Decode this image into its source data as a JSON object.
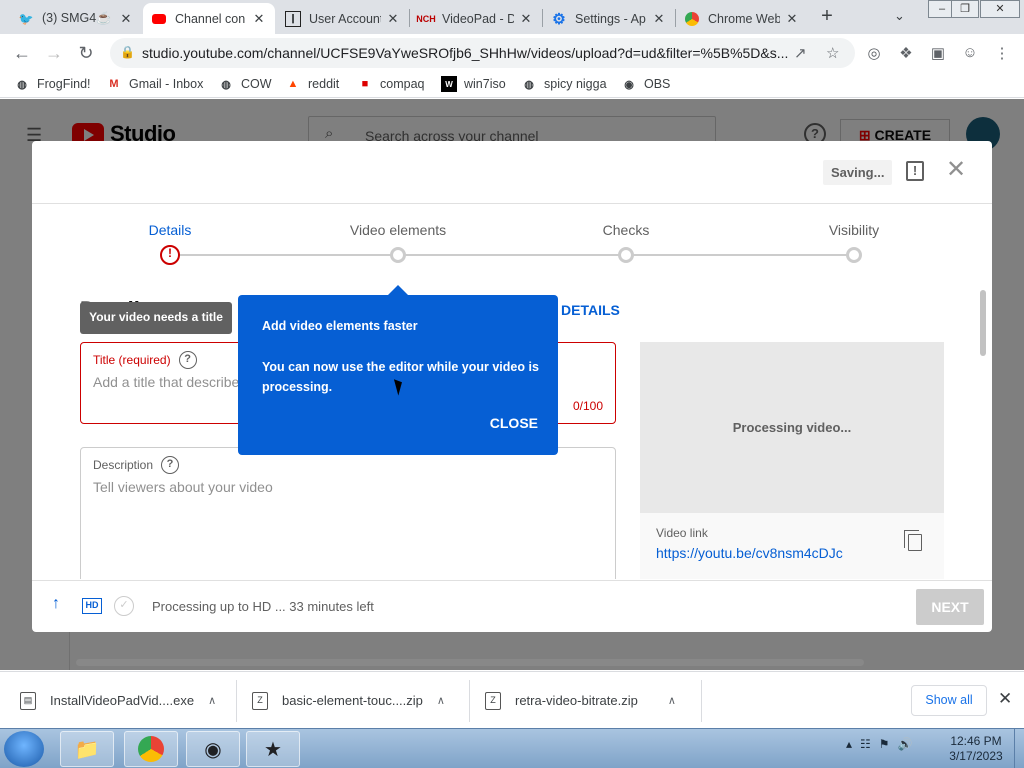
{
  "browser": {
    "tabs": [
      {
        "label": "(3) SMG4☕",
        "icon": "twitter-icon",
        "active": false
      },
      {
        "label": "Channel con",
        "icon": "youtube-icon",
        "active": true
      },
      {
        "label": "User Account",
        "icon": "archive-icon",
        "active": false
      },
      {
        "label": "VideoPad - D",
        "icon": "nch-icon",
        "active": false
      },
      {
        "label": "Settings - Ap",
        "icon": "gear-icon",
        "active": false
      },
      {
        "label": "Chrome Web",
        "icon": "chrome-web-store-icon",
        "active": false
      }
    ],
    "url": "studio.youtube.com/channel/UCFSE9VaYweSROfjb6_SHhHw/videos/upload?d=ud&filter=%5B%5D&s...",
    "bookmarks": [
      {
        "label": "FrogFind!",
        "icon": "globe-icon"
      },
      {
        "label": "Gmail - Inbox",
        "icon": "gmail-icon"
      },
      {
        "label": "COW",
        "icon": "globe-icon"
      },
      {
        "label": "reddit",
        "icon": "reddit-icon"
      },
      {
        "label": "compaq",
        "icon": "compaq-icon"
      },
      {
        "label": "win7iso",
        "icon": "w-icon"
      },
      {
        "label": "spicy nigga",
        "icon": "globe-icon"
      },
      {
        "label": "OBS",
        "icon": "github-icon"
      }
    ]
  },
  "studio": {
    "logo_text": "Studio",
    "search_placeholder": "Search across your channel",
    "create_label": "CREATE"
  },
  "dialog": {
    "saving_label": "Saving...",
    "steps": [
      {
        "label": "Details",
        "state": "error"
      },
      {
        "label": "Video elements",
        "state": "pending"
      },
      {
        "label": "Checks",
        "state": "pending"
      },
      {
        "label": "Visibility",
        "state": "pending"
      }
    ],
    "details_heading": "Details",
    "show_more_label": "DETAILS",
    "title_tooltip": "Your video needs a title",
    "title_field": {
      "label": "Title (required)",
      "placeholder": "Add a title that describes your video",
      "counter": "0/100"
    },
    "description_field": {
      "label": "Description",
      "placeholder": "Tell viewers about your video"
    },
    "preview": {
      "status": "Processing video...",
      "link_label": "Video link",
      "link": "https://youtu.be/cv8nsm4cDJc"
    },
    "footer": {
      "hd_label": "HD",
      "status": "Processing up to HD ... 33 minutes left",
      "next_label": "NEXT"
    }
  },
  "popover": {
    "title": "Add video elements faster",
    "body": "You can now use the editor while your video is processing.",
    "close_label": "CLOSE"
  },
  "downloads": {
    "items": [
      {
        "name": "InstallVideoPadVid....exe"
      },
      {
        "name": "basic-element-touc....zip"
      },
      {
        "name": "retra-video-bitrate.zip"
      }
    ],
    "show_all_label": "Show all"
  },
  "taskbar": {
    "time": "12:46 PM",
    "date": "3/17/2023"
  },
  "colors": {
    "accent": "#065fd4",
    "error": "#cc0000",
    "youtube_red": "#ff0000"
  }
}
